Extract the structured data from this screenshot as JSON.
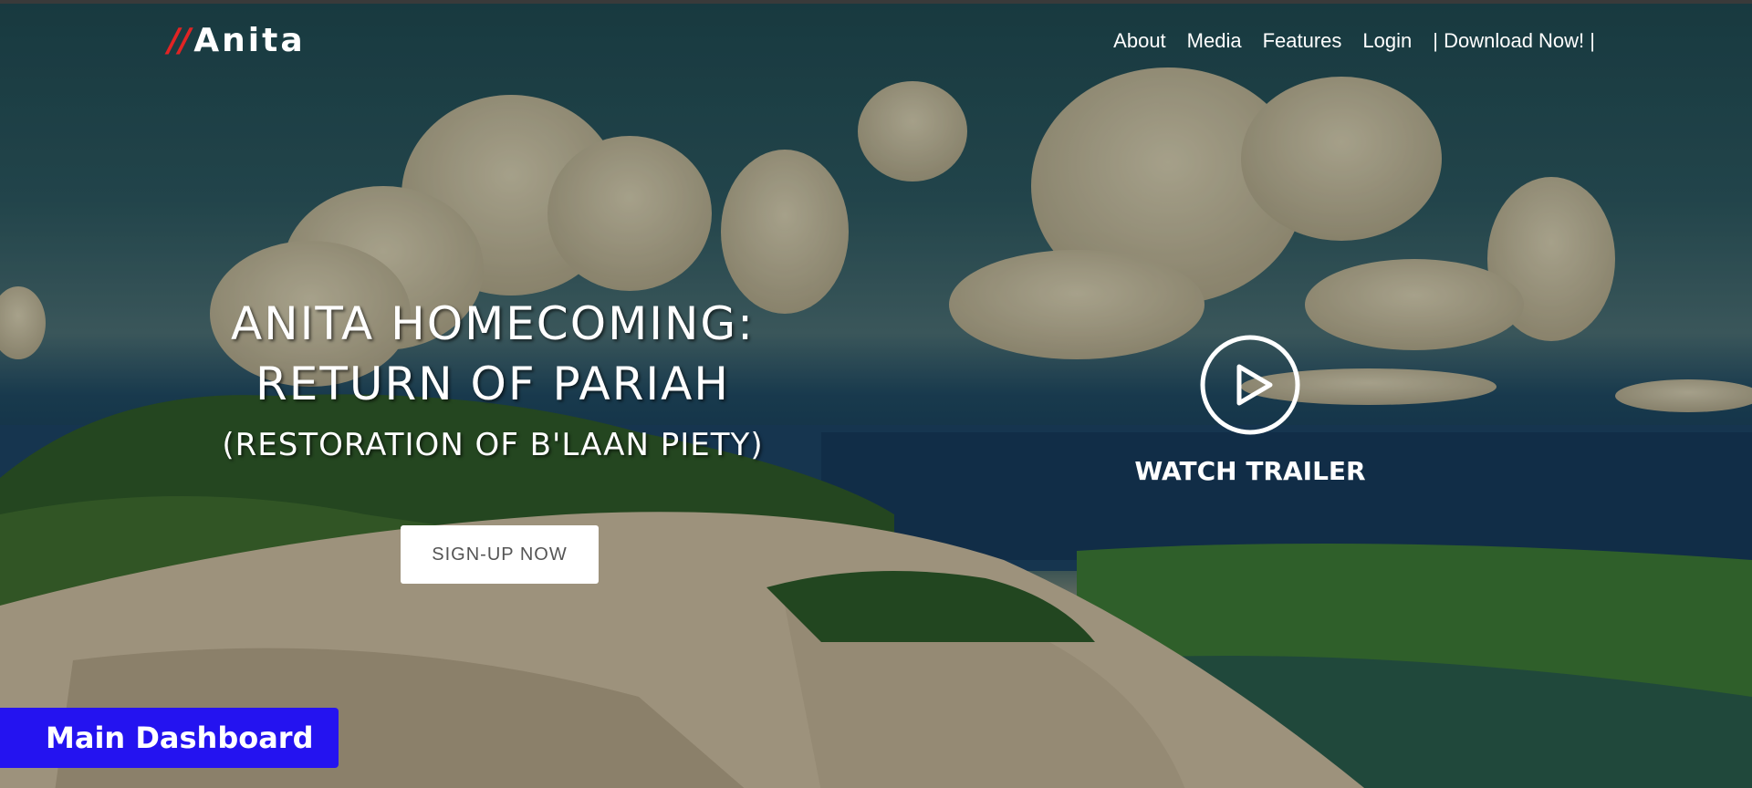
{
  "header": {
    "logo": {
      "slashes": "//",
      "name": "Anita"
    },
    "nav": [
      "About",
      "Media",
      "Features",
      "Login",
      "| Download Now! |"
    ]
  },
  "hero": {
    "title_line1": "ANITA HOMECOMING:",
    "title_line2": "RETURN OF PARIAH",
    "subtitle": "(RESTORATION OF B'LAAN PIETY)",
    "signup_label": "SIGN-UP NOW"
  },
  "trailer": {
    "icon": "play-circle-icon",
    "label": "WATCH TRAILER"
  },
  "dashboard": {
    "label": "Main Dashboard"
  },
  "colors": {
    "logo_accent": "#e02424",
    "dashboard_button": "#2413f0",
    "sky": "#1f4a52",
    "sea": "#173b55",
    "grass": "#3e6e2c",
    "sand": "#c7b99e"
  }
}
